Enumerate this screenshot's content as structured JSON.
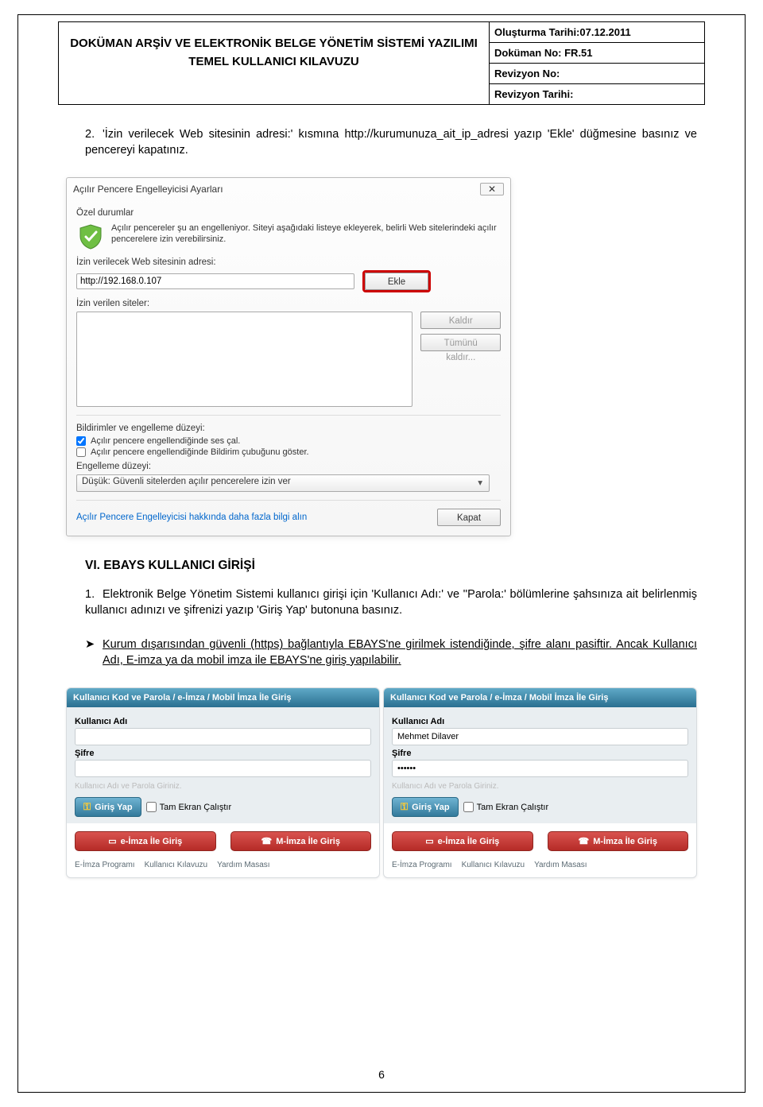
{
  "header": {
    "title1": "DOKÜMAN ARŞİV VE ELEKTRONİK BELGE YÖNETİM SİSTEMİ YAZILIMI",
    "title2": "TEMEL KULLANICI KILAVUZU",
    "meta1": "Oluşturma Tarihi:07.12.2011",
    "meta2": "Doküman No: FR.51",
    "meta3": "Revizyon No:",
    "meta4": "Revizyon Tarihi:"
  },
  "para1_num": "2.",
  "para1": "'İzin verilecek Web sitesinin adresi:' kısmına http://kurumunuza_ait_ip_adresi yazıp 'Ekle' düğmesine basınız ve pencereyi kapatınız.",
  "dialog": {
    "title": "Açılır Pencere Engelleyicisi Ayarları",
    "close": "✕",
    "group": "Özel durumlar",
    "info": "Açılır pencereler şu an engelleniyor. Siteyi aşağıdaki listeye ekleyerek, belirli Web sitelerindeki açılır pencerelere izin verebilirsiniz.",
    "url_label": "İzin verilecek Web sitesinin adresi:",
    "url_value": "http://192.168.0.107",
    "btn_ekle": "Ekle",
    "sites_label": "İzin verilen siteler:",
    "btn_kaldir": "Kaldır",
    "btn_tumunu": "Tümünü kaldır...",
    "notif_label": "Bildirimler ve engelleme düzeyi:",
    "chk1": "Açılır pencere engellendiğinde ses çal.",
    "chk2": "Açılır pencere engellendiğinde Bildirim çubuğunu göster.",
    "level_label": "Engelleme düzeyi:",
    "level_value": "Düşük: Güvenli sitelerden açılır pencerelere izin ver",
    "link": "Açılır Pencere Engelleyicisi hakkında daha fazla bilgi alın",
    "btn_kapat": "Kapat"
  },
  "section6": "VI. EBAYS KULLANICI GİRİŞİ",
  "item1_num": "1.",
  "item1": "Elektronik Belge Yönetim Sistemi kullanıcı girişi için 'Kullanıcı Adı:' ve ''Parola:' bölümlerine şahsınıza ait belirlenmiş kullanıcı adınızı ve şifrenizi yazıp 'Giriş Yap' butonuna basınız.",
  "bullet_sym": "➤",
  "bullet_text": "Kurum dışarısından güvenli (https) bağlantıyla EBAYS'ne girilmek istendiğinde, şifre alanı pasiftir. Ancak Kullanıcı Adı, E-imza ya da mobil imza ile EBAYS'ne giriş yapılabilir.",
  "login": {
    "head": "Kullanıcı Kod ve Parola / e-İmza / Mobil İmza İle Giriş",
    "lbl_user": "Kullanıcı Adı",
    "val_user_right": "Mehmet Dilaver",
    "lbl_pass": "Şifre",
    "val_pass_right": "••••••",
    "placeholder": "Kullanıcı Adı ve Parola Giriniz.",
    "btn_giris": "Giriş Yap",
    "chk_full": "Tam Ekran Çalıştır",
    "btn_eimza": "e-İmza İle Giriş",
    "btn_mimza": "M-İmza İle Giriş",
    "link1": "E-İmza Programı",
    "link2": "Kullanıcı Kılavuzu",
    "link3": "Yardım Masası"
  },
  "page_number": "6"
}
